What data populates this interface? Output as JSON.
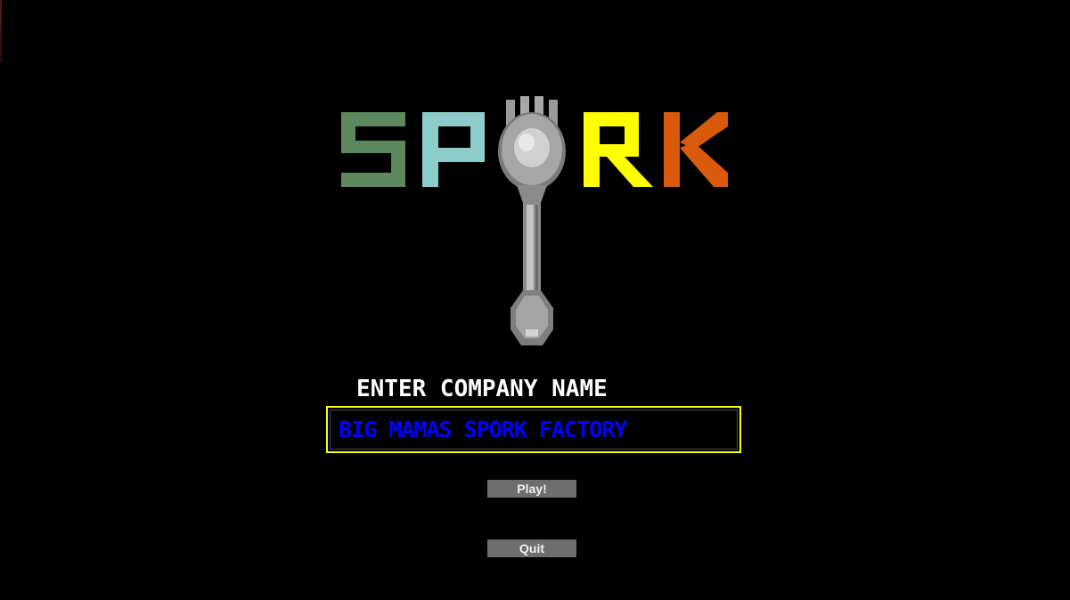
{
  "logo": {
    "text": "SPORK",
    "letter_colors": {
      "S": "#5c8a5e",
      "P": "#8ecccc",
      "R": "#ffff00",
      "K": "#d95a0a"
    },
    "icon": "spork-icon"
  },
  "prompt": {
    "label": "ENTER COMPANY NAME"
  },
  "company_name": {
    "value": "BIG MAMAS SPORK FACTORY",
    "text_color": "#0000ff",
    "border_color": "#ffff00"
  },
  "menu": {
    "play_label": "Play!",
    "quit_label": "Quit"
  },
  "colors": {
    "background": "#000000",
    "button_bg": "#6e6e6e",
    "button_text": "#f0f0f0"
  }
}
